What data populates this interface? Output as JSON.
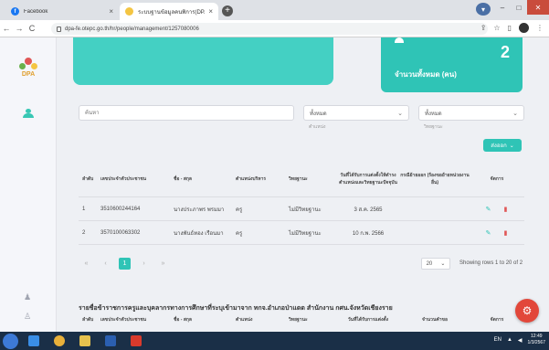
{
  "browser": {
    "tabs": [
      {
        "title": "Facebook",
        "favicon": "facebook-icon",
        "active": false
      },
      {
        "title": "ระบบฐานข้อมูลคนพิการ(DPA)",
        "favicon": "dpa-icon",
        "active": true
      }
    ],
    "url": "dpa-fe.otepc.go.th/hr/people/management/1257080006"
  },
  "sidebar": {
    "logo_text": "DPA",
    "items": [
      {
        "icon": "users-icon"
      }
    ],
    "bottom_items": [
      {
        "icon": "bell-icon"
      },
      {
        "icon": "user-icon"
      }
    ]
  },
  "stat_card": {
    "value": "2",
    "label": "จำนวนทั้งหมด (คน)"
  },
  "filters": {
    "search_placeholder": "ค้นหา",
    "select1": {
      "value": "ทั้งหมด",
      "caption": "ตำแหน่ง"
    },
    "select2": {
      "value": "ทั้งหมด",
      "caption": "วิทยฐานะ"
    },
    "button_label": "ส่งออก"
  },
  "table": {
    "columns": [
      "ลำดับ",
      "เลขประจำตัวประชาชน",
      "ชื่อ - สกุล",
      "ตำแหน่งบริหาร",
      "วิทยฐานะ",
      "วันที่ได้รับการแต่งตั้งให้ดำรงตำแหน่งและวิทยฐานะปัจจุบัน",
      "กรณีย้ายออก (ร้องขอย้ายหน่วยงานอื่น)",
      "จัดการ"
    ],
    "rows": [
      {
        "no": "1",
        "id": "3510600244164",
        "name": "นางประภาพร พรมมา",
        "position": "ครู",
        "rank": "ไม่มีวิทยฐานะ",
        "date": "3 ส.ค. 2565",
        "move": ""
      },
      {
        "no": "2",
        "id": "3570100063302",
        "name": "นางพันธ์ทอง เรือนมา",
        "position": "ครู",
        "rank": "ไม่มีวิทยฐานะ",
        "date": "10 ก.พ. 2566",
        "move": ""
      }
    ]
  },
  "pagination": {
    "pages": [
      "«",
      "‹",
      "1",
      "›",
      "»"
    ],
    "current": "1",
    "page_size": "20",
    "info": "Showing rows 1 to 20 of 2"
  },
  "section2": {
    "title": "รายชื่อข้าราชการครูและบุคลากรทางการศึกษาที่ระบุเข้ามาจาก ทกจ.อำเภอป่าแดด สำนักงาน กศน.จังหวัดเชียงราย",
    "columns": [
      "ลำดับ",
      "เลขประจำตัวประชาชน",
      "ชื่อ - สกุล",
      "ตำแหน่ง",
      "วิทยฐานะ",
      "วันที่ได้รับการแต่งตั้ง",
      "จำนวนคำขอ",
      "จัดการ"
    ]
  },
  "taskbar": {
    "lang": "EN",
    "time": "12:49",
    "date": "1/3/2567"
  },
  "colors": {
    "accent": "#2fc4b6",
    "danger": "#e05656",
    "hero": "#44d0c3"
  }
}
